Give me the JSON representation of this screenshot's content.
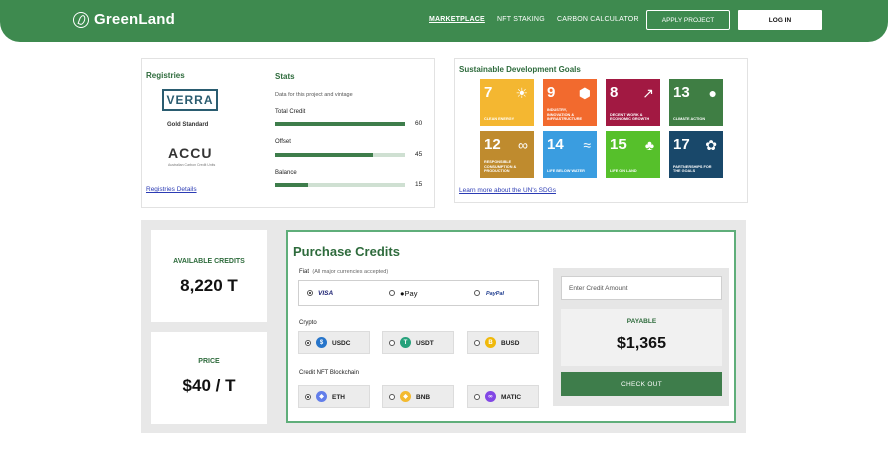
{
  "nav": {
    "brand": "GreenLand",
    "links": [
      "MARKETPLACE",
      "NFT STAKING",
      "CARBON CALCULATOR"
    ],
    "apply": "APPLY PROJECT",
    "login": "LOG IN"
  },
  "registries": {
    "title": "Registries",
    "logos": {
      "verra": "VERRA",
      "gold": "Gold Standard",
      "accu": "ACCU",
      "accu_sub": "Australian Carbon Credit Units"
    },
    "link": "Registries Details"
  },
  "stats": {
    "title": "Stats",
    "subtitle": "Data for this project and vintage",
    "items": [
      {
        "label": "Total Credit",
        "value": "60",
        "fraction": 1.0
      },
      {
        "label": "Offset",
        "value": "45",
        "fraction": 0.75
      },
      {
        "label": "Balance",
        "value": "15",
        "fraction": 0.25
      }
    ]
  },
  "sdg": {
    "title": "Sustainable  Development Goals",
    "tiles": [
      {
        "num": "7",
        "text": "CLEAN ENERGY",
        "color": "#f4b731",
        "icon": "sun-icon"
      },
      {
        "num": "9",
        "text": "INDUSTRY, INNOVATION & INFRASTRUCTURE",
        "color": "#f26a2e",
        "icon": "cubes-icon"
      },
      {
        "num": "8",
        "text": "DECENT WORK & ECONOMIC GROWTH",
        "color": "#a21942",
        "icon": "growth-icon"
      },
      {
        "num": "13",
        "text": "CLIMATE ACTION",
        "color": "#3f7e44",
        "icon": "globe-icon"
      },
      {
        "num": "12",
        "text": "RESPONSIBLE CONSUMPTION & PRODUCTION",
        "color": "#bf8b2e",
        "icon": "infinity-icon"
      },
      {
        "num": "14",
        "text": "LIFE BELOW WATER",
        "color": "#3a9de0",
        "icon": "fish-icon"
      },
      {
        "num": "15",
        "text": "LIFE ON LAND",
        "color": "#56c02b",
        "icon": "tree-icon"
      },
      {
        "num": "17",
        "text": "PARTNERSHIPS FOR THE GOALS",
        "color": "#19486a",
        "icon": "flower-icon"
      }
    ],
    "link": "Learn more about the UN's SDGs"
  },
  "available": {
    "label": "AVAILABLE CREDITS",
    "value": "8,220 T"
  },
  "price": {
    "label": "PRICE",
    "value": "$40 / T"
  },
  "purchase": {
    "title": "Purchase Credits",
    "fiat_label": "Fiat",
    "fiat_sub": "(All major currencies accepted)",
    "fiat_options": [
      "VISA",
      "Pay",
      "PayPal"
    ],
    "crypto_label": "Crypto",
    "crypto_options": [
      {
        "name": "USDC",
        "color": "#2775ca",
        "glyph": "$"
      },
      {
        "name": "USDT",
        "color": "#26a17b",
        "glyph": "T"
      },
      {
        "name": "BUSD",
        "color": "#f0b90b",
        "glyph": "B"
      }
    ],
    "nft_label": "Credit NFT Blockchain",
    "nft_options": [
      {
        "name": "ETH",
        "color": "#627eea",
        "glyph": "◆"
      },
      {
        "name": "BNB",
        "color": "#f3ba2f",
        "glyph": "◆"
      },
      {
        "name": "MATIC",
        "color": "#8247e5",
        "glyph": "∞"
      }
    ],
    "amount_placeholder": "Enter Credit Amount",
    "payable_label": "PAYABLE",
    "payable_value": "$1,365",
    "checkout": "CHECK OUT"
  }
}
